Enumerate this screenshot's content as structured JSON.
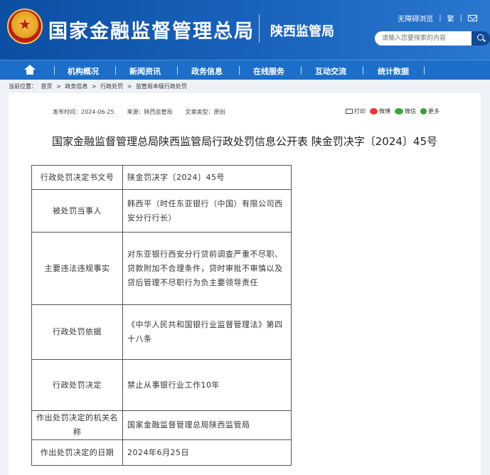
{
  "header": {
    "site_title": "国家金融监督管理总局",
    "sub_title": "陕西监管局",
    "top_links": [
      "无障碍浏览",
      "繁"
    ],
    "search_placeholder": "请输入您要搜索的内容"
  },
  "nav": {
    "items": [
      "机构概况",
      "新闻资讯",
      "政务信息",
      "在线服务",
      "互动交流",
      "统计数据"
    ]
  },
  "breadcrumb": {
    "label": "当前位置：",
    "items": [
      "首页",
      "政务信息",
      "行政处罚",
      "监管局本级行政处罚"
    ],
    "separator": ">"
  },
  "meta": {
    "publish_time": "发布时间：2024-06-25",
    "source": "来源：陕西监管局",
    "doc_type": "文章类型：原创"
  },
  "share": {
    "print": "打印",
    "weibo": "微博",
    "wechat": "微信",
    "more": "更多"
  },
  "document": {
    "title": "国家金融监督管理总局陕西监管局行政处罚信息公开表 陕金罚决字〔2024〕45号"
  },
  "table": {
    "rows": [
      {
        "label": "行政处罚决定书文号",
        "value": "陕金罚决字〔2024〕45号"
      },
      {
        "label": "被处罚当事人",
        "value": "韩西平（时任东亚银行（中国）有限公司西安分行行长）"
      },
      {
        "label": "主要违法违规事实",
        "value": "对东亚银行西安分行贷前调查严重不尽职、贷款附加不合理条件，贷时审批不审慎以及贷后管理不尽职行为负主要领导责任"
      },
      {
        "label": "行政处罚依据",
        "value": "《中华人民共和国银行业监督管理法》第四十八条"
      },
      {
        "label": "行政处罚决定",
        "value": "禁止从事银行业工作10年"
      },
      {
        "label": "作出处罚决定的机关名称",
        "value": "国家金融监督管理总局陕西监管局"
      },
      {
        "label": "作出处罚决定的日期",
        "value": "2024年6月25日"
      }
    ]
  }
}
